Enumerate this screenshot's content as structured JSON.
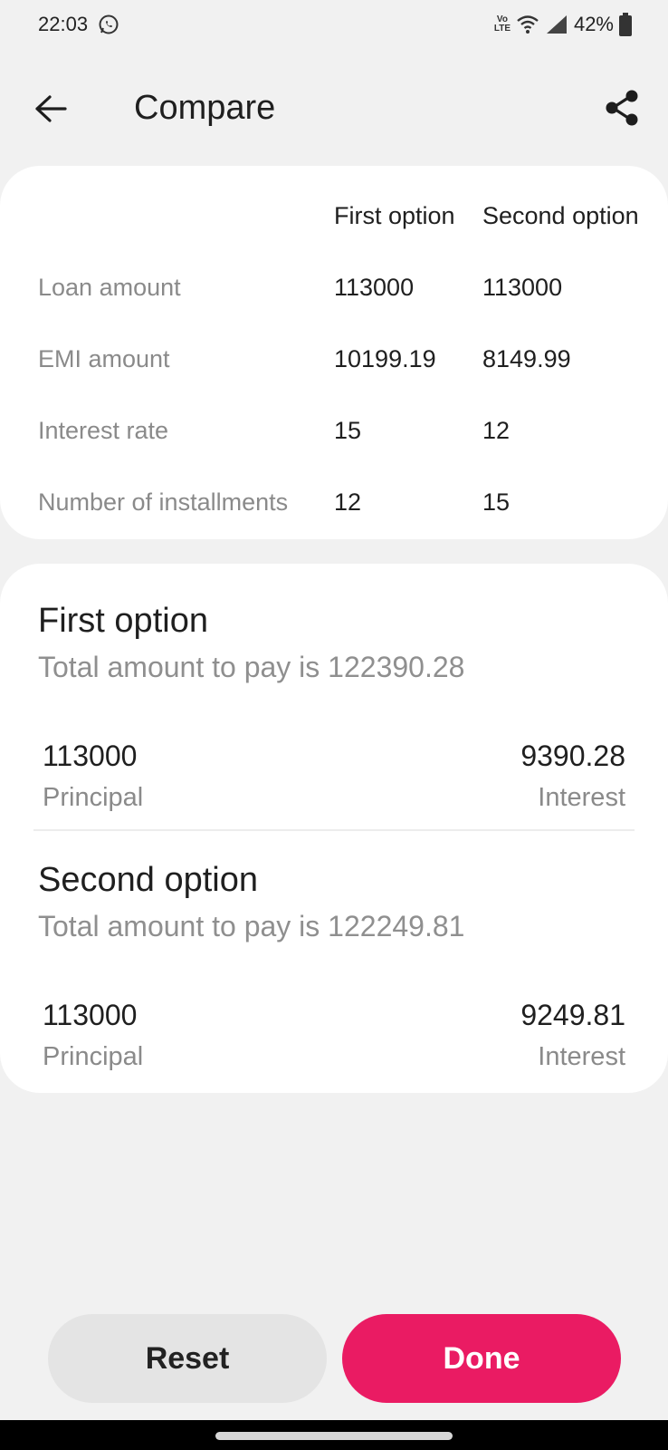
{
  "status_bar": {
    "time": "22:03",
    "battery": "42%",
    "volte_top": "Vo",
    "volte_bottom": "LTE",
    "icons": [
      "whatsapp-icon",
      "volte-icon",
      "wifi-icon",
      "signal-icon",
      "battery-icon"
    ]
  },
  "app_bar": {
    "title": "Compare",
    "back_icon": "arrow-left-icon",
    "share_icon": "share-icon"
  },
  "comparison": {
    "columns": [
      "First option",
      "Second option"
    ],
    "rows": [
      {
        "label": "Loan amount",
        "first": "113000",
        "second": "113000"
      },
      {
        "label": "EMI amount",
        "first": "10199.19",
        "second": "8149.99"
      },
      {
        "label": "Interest rate",
        "first": "15",
        "second": "12"
      },
      {
        "label": "Number of installments",
        "first": "12",
        "second": "15"
      }
    ]
  },
  "options": [
    {
      "title": "First option",
      "total": "Total amount to pay is 122390.28",
      "principal_value": "113000",
      "principal_label": "Principal",
      "interest_value": "9390.28",
      "interest_label": "Interest"
    },
    {
      "title": "Second option",
      "total": "Total amount to pay is 122249.81",
      "principal_value": "113000",
      "principal_label": "Principal",
      "interest_value": "9249.81",
      "interest_label": "Interest"
    }
  ],
  "buttons": {
    "reset": "Reset",
    "done": "Done"
  },
  "colors": {
    "accent": "#ea1b63",
    "background": "#f1f1f1",
    "card": "#ffffff",
    "secondary_button": "#e4e4e4"
  }
}
